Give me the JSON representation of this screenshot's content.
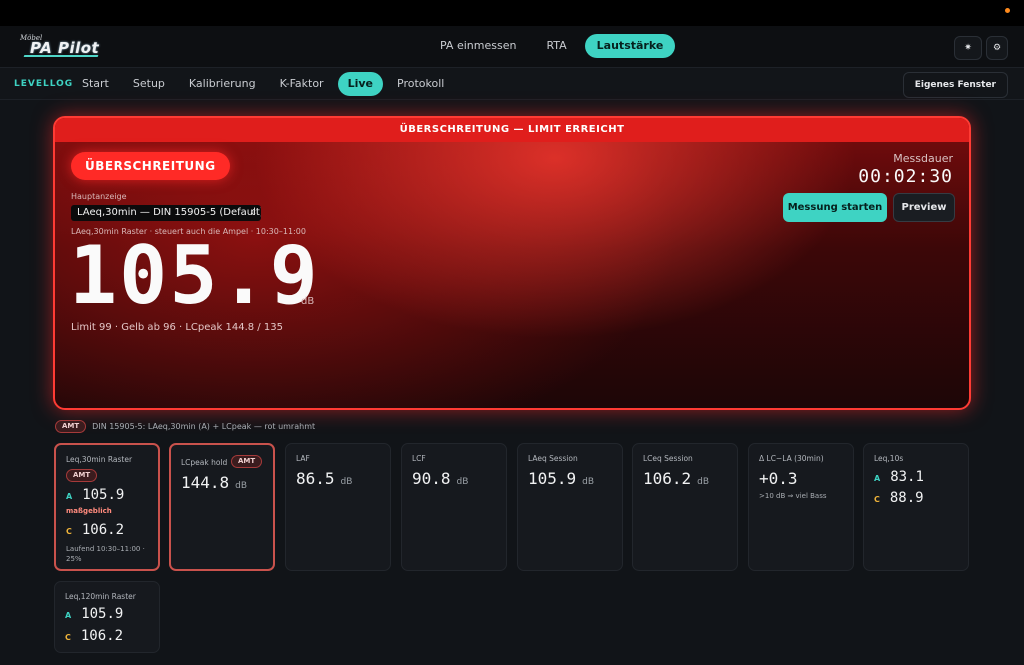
{
  "header": {
    "logo_sup": "Möbel",
    "logo_main": "PA Pilot",
    "main_tabs": [
      {
        "label": "PA einmessen",
        "active": false
      },
      {
        "label": "RTA",
        "active": false
      },
      {
        "label": "Lautstärke",
        "active": true
      }
    ],
    "icons": [
      "brightness-icon",
      "settings-icon"
    ]
  },
  "subnav": {
    "brand": "LEVELLOG",
    "tabs": [
      {
        "label": "Start",
        "active": false
      },
      {
        "label": "Setup",
        "active": false
      },
      {
        "label": "Kalibrierung",
        "active": false
      },
      {
        "label": "K-Faktor",
        "active": false
      },
      {
        "label": "Live",
        "active": true
      },
      {
        "label": "Protokoll",
        "active": false
      }
    ],
    "own_window": "Eigenes Fenster"
  },
  "alarm": {
    "banner": "ÜBERSCHREITUNG — LIMIT ERREICHT",
    "status_badge": "ÜBERSCHREITUNG",
    "main_label": "Hauptanzeige",
    "select_value": "LAeq,30min — DIN 15905-5 (Default)",
    "raster_note": "LAeq,30min Raster · steuert auch die Ampel · 10:30–11:00",
    "main_value": "105.9",
    "main_unit": "dB",
    "limit_line": "Limit 99 · Gelb ab 96 · LCpeak 144.8 / 135",
    "duration_label": "Messdauer",
    "duration": "00:02:30",
    "start_button": "Messung starten",
    "preview_button": "Preview",
    "colors": {
      "alarm": "#ff2a26",
      "accent": "#3ed3c3"
    }
  },
  "legend": {
    "badge": "AMT",
    "text": "DIN 15905-5: LAeq,30min (A) + LCpeak — rot umrahmt"
  },
  "tiles": {
    "leq30": {
      "label": "Leq,30min Raster",
      "badge": "AMT",
      "a_key": "A",
      "a_value": "105.9",
      "note": "maßgeblich",
      "c_key": "C",
      "c_value": "106.2",
      "running": "Laufend 10:30–11:00 · 25%"
    },
    "lcpeak": {
      "label": "LCpeak hold",
      "badge": "AMT",
      "value": "144.8",
      "unit": "dB"
    },
    "laf": {
      "label": "LAF",
      "value": "86.5",
      "unit": "dB"
    },
    "lcf": {
      "label": "LCF",
      "value": "90.8",
      "unit": "dB"
    },
    "laeq_session": {
      "label": "LAeq Session",
      "value": "105.9",
      "unit": "dB"
    },
    "lceq_session": {
      "label": "LCeq Session",
      "value": "106.2",
      "unit": "dB"
    },
    "delta": {
      "label": "Δ LC−LA (30min)",
      "value": "+0.3",
      "note": ">10 dB ⇒ viel Bass"
    },
    "leq10": {
      "label": "Leq,10s",
      "a_key": "A",
      "a_value": "83.1",
      "c_key": "C",
      "c_value": "88.9"
    },
    "leq120": {
      "label": "Leq,120min Raster",
      "a_key": "A",
      "a_value": "105.9",
      "c_key": "C",
      "c_value": "106.2"
    }
  }
}
